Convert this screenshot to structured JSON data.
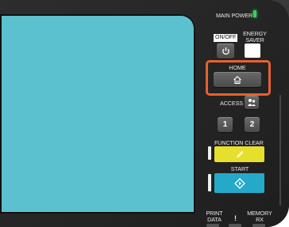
{
  "labels": {
    "main_power": "MAIN POWER",
    "on_off": "ON/OFF",
    "energy_saver": "ENERGY SAVER",
    "home": "HOME",
    "access": "ACCESS",
    "function_clear": "FUNCTION CLEAR",
    "start": "START",
    "print_data": "PRINT DATA",
    "memory_rx": "MEMORY RX",
    "exclaim": "!"
  },
  "keys": {
    "one": "1",
    "two": "2"
  },
  "colors": {
    "screen": "#5cc1cf",
    "highlight": "#e8612e",
    "function_clear": "#e6df2c",
    "start": "#25a9c9",
    "led_green": "#3bd160"
  },
  "icons": {
    "power": "power-icon",
    "home": "home-icon",
    "access": "user-icon",
    "clear": "clear-icon",
    "start": "start-icon"
  }
}
